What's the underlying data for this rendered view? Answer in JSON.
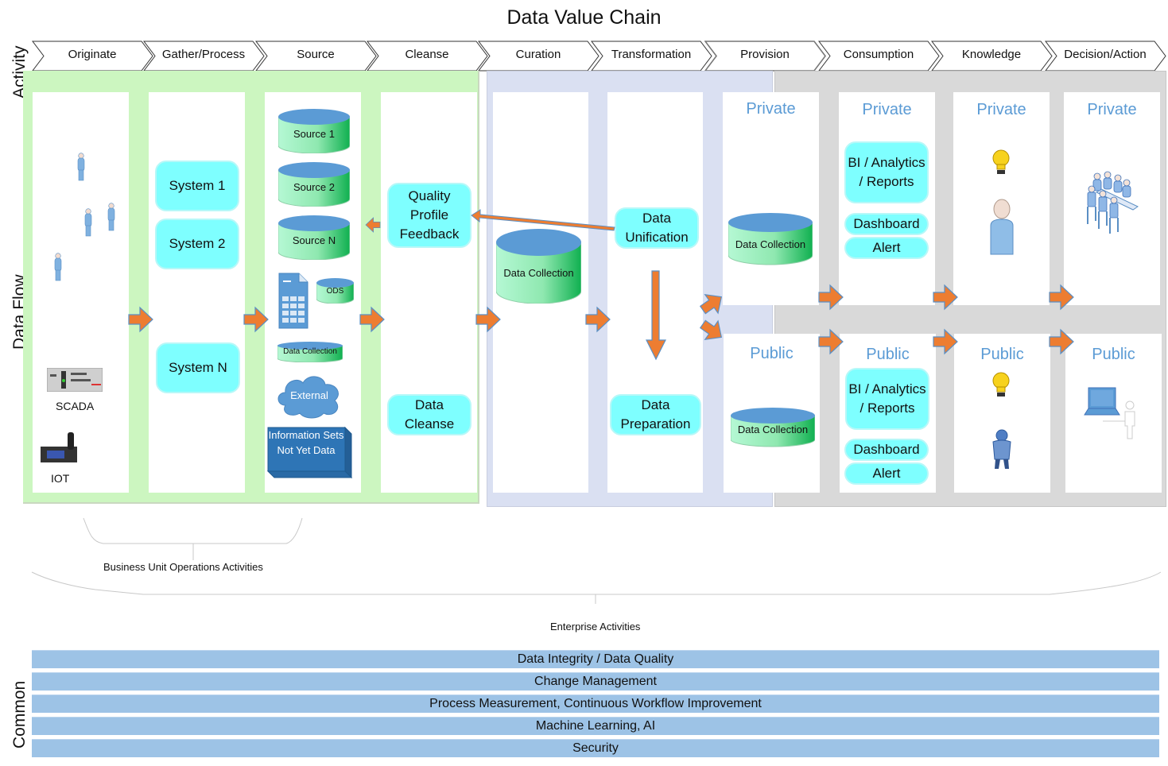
{
  "title": "Data Value Chain",
  "side_labels": {
    "activity": "Activity",
    "data_flow": "Data Flow",
    "common": "Common"
  },
  "activities": [
    "Originate",
    "Gather/Process",
    "Source",
    "Cleanse",
    "Curation",
    "Transformation",
    "Provision",
    "Consumption",
    "Knowledge",
    "Decision/Action"
  ],
  "originate": {
    "scada": "SCADA",
    "iot": "IOT"
  },
  "gather": {
    "systems": [
      "System 1",
      "System 2",
      "System N"
    ]
  },
  "source": {
    "sources": [
      "Source 1",
      "Source 2",
      "Source N"
    ],
    "ods": "ODS",
    "data_collection": "Data Collection",
    "external": "External",
    "info_sets": "Information Sets Not Yet Data"
  },
  "cleanse": {
    "feedback": "Quality Profile Feedback",
    "cleanse": "Data Cleanse"
  },
  "curation": {
    "data_collection": "Data Collection"
  },
  "transformation": {
    "unification": "Data Unification",
    "preparation": "Data Preparation"
  },
  "provision": {
    "private": "Private",
    "public": "Public",
    "private_collection": "Data Collection",
    "public_collection": "Data Collection"
  },
  "consumption": {
    "private": "Private",
    "public": "Public",
    "bi": "BI / Analytics / Reports",
    "dashboard": "Dashboard",
    "alert": "Alert"
  },
  "knowledge": {
    "private": "Private",
    "public": "Public"
  },
  "decision": {
    "private": "Private",
    "public": "Public"
  },
  "brackets": {
    "business_unit": "Business Unit Operations Activities",
    "enterprise": "Enterprise Activities"
  },
  "common_bands": [
    "Data Integrity / Data Quality",
    "Change Management",
    "Process Measurement, Continuous Workflow Improvement",
    "Machine Learning, AI",
    "Security"
  ],
  "colors": {
    "green_region": "#ccf6c0",
    "blue_region": "#dae0f2",
    "gray_region": "#d9d9d9",
    "pill": "#7effff",
    "arrow": "#ed7d31",
    "band": "#9dc3e6",
    "private_public_text": "#5b9bd5"
  }
}
